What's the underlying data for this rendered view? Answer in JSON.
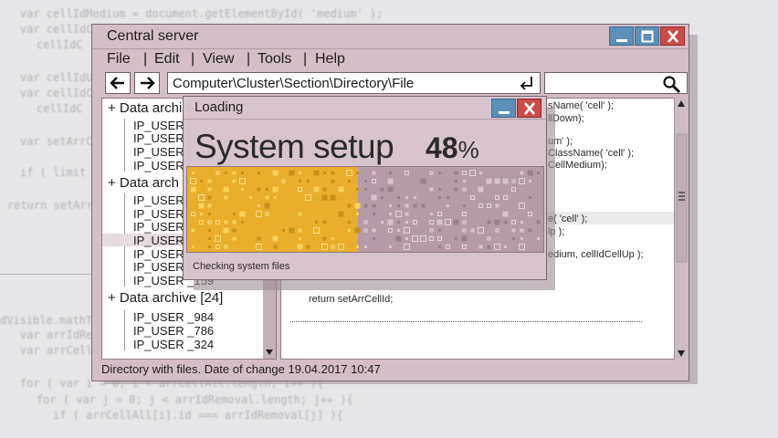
{
  "background_code": [
    "var cellIdMedium = document.getElementById( 'medium' );",
    "var cellIdC",
    "cellIdC",
    "var cellIdU",
    "var cellIdC",
    "cellIdC",
    "var setArrC",
    "if ( limit !==",
    "return setArrC",
    "dVisible.mathTr",
    "var arrIdRe",
    "var arrCellA",
    "for ( var i = 0; i < arrCellAll.length; i++ ){",
    "for ( var j = 0; j < arrIdRemoval.length; j++ ){",
    "if ( arrCellAll[i].id === arrIdRemoval[j] ){"
  ],
  "window": {
    "title": "Central server",
    "menu": [
      "File",
      "Edit",
      "View",
      "Tools",
      "Help"
    ],
    "address": "Computer\\Cluster\\Section\\Directory\\File",
    "status_text": "Directory with files. Date of change 19.04.2017   10:47"
  },
  "tree": {
    "nodes": [
      {
        "label": "+ Data archi",
        "leaves": [
          "IP_USER",
          "IP_USER",
          "IP_USER",
          "IP_USER"
        ]
      },
      {
        "label": "+ Data arch",
        "leaves": [
          "IP_USER",
          "IP_USER",
          "IP_USER",
          "IP_USER",
          "IP_USER",
          "IP_USER",
          "IP_USER _159"
        ]
      },
      {
        "label": "+ Data archive [24]",
        "leaves": [
          "IP_USER _984",
          "IP_USER _786",
          "IP_USER _324"
        ]
      }
    ]
  },
  "code_lines": [
    "sName( 'cell' );",
    "llDown);",
    "um' );",
    "ClassName( 'cell' );",
    "CellMedium);",
    "e( 'cell' );",
    "lp );",
    "edium, cellIdCellUp );",
    "return setArrCellId;"
  ],
  "dialog": {
    "title": "Loading",
    "heading": "System setup",
    "percent_value": "48",
    "percent_sign": "%",
    "progress": 0.48,
    "status": "Checking system files"
  },
  "colors": {
    "window_bg": "#d4bec8",
    "progress_fill": "#e9ae2c",
    "progress_track": "#b59ba8",
    "button_blue": "#5c8fb8",
    "button_red": "#cc4a48"
  },
  "icons": {
    "minimize": "minimize-icon",
    "maximize": "maximize-icon",
    "close": "close-icon",
    "back": "arrow-left-icon",
    "forward": "arrow-right-icon",
    "enter": "enter-icon",
    "search": "search-icon"
  }
}
